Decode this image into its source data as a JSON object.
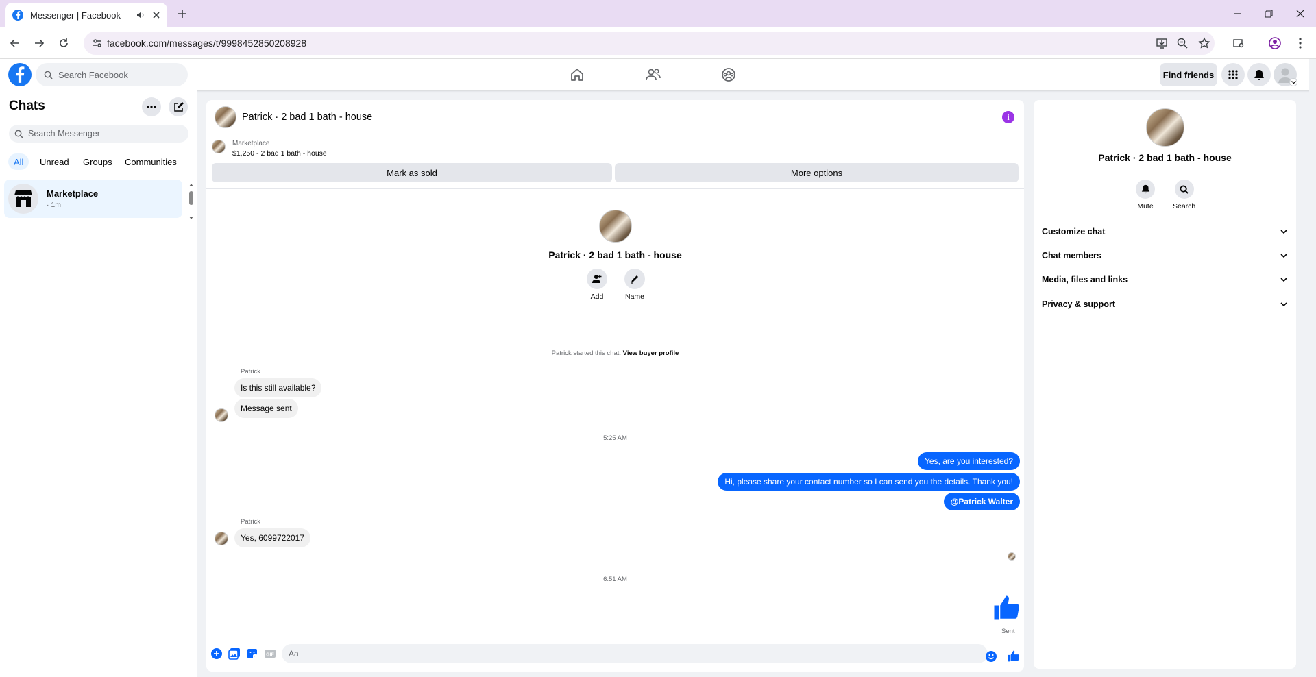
{
  "browser": {
    "tab_title": "Messenger | Facebook",
    "url": "facebook.com/messages/t/9998452850208928"
  },
  "header": {
    "search_placeholder": "Search Facebook",
    "find_friends": "Find friends"
  },
  "sidebar": {
    "title": "Chats",
    "search_placeholder": "Search Messenger",
    "filters": [
      "All",
      "Unread",
      "Groups",
      "Communities"
    ],
    "active_filter": "All",
    "chat": {
      "name": "Marketplace",
      "time": "· 1m"
    }
  },
  "conversation": {
    "title": "Patrick · 2 bad 1 bath - house",
    "marketplace_label": "Marketplace",
    "listing": "$1,250 - 2 bad 1 bath - house",
    "mark_sold": "Mark as sold",
    "more_options": "More options",
    "intro_name": "Patrick · 2 bad 1 bath - house",
    "add_label": "Add",
    "name_label": "Name",
    "started_text": "Patrick started this chat.",
    "view_profile": "View buyer profile",
    "sender1": "Patrick",
    "msg1": "Is this still available?",
    "msg2": "Message sent",
    "time1": "5:25 AM",
    "out1": "Yes, are you interested?",
    "out2": "Hi, please share your contact number so I can send you the details. Thank you!",
    "out3": "@Patrick Walter",
    "sender2": "Patrick",
    "msg3": "Yes, 6099722017",
    "time2": "6:51 AM",
    "sent_label": "Sent",
    "composer_placeholder": "Aa"
  },
  "details": {
    "name": "Patrick · 2 bad 1 bath - house",
    "mute": "Mute",
    "search": "Search",
    "sections": [
      "Customize chat",
      "Chat members",
      "Media, files and links",
      "Privacy & support"
    ]
  },
  "colors": {
    "brand": "#1877f2",
    "outgoing": "#0866ff",
    "info": "#9b34e6"
  }
}
